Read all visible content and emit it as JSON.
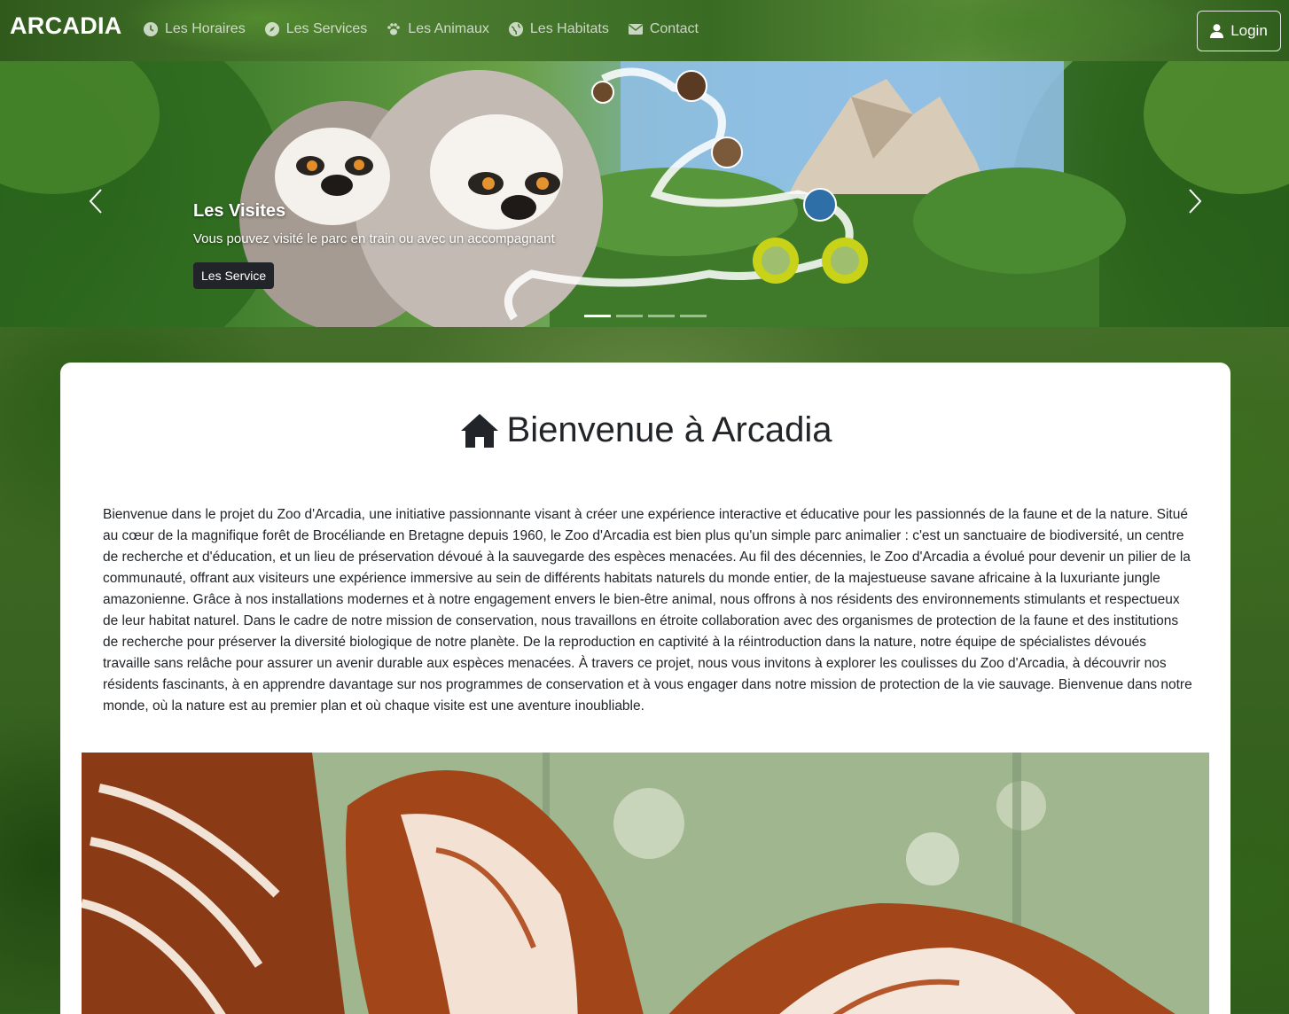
{
  "navbar": {
    "brand": "ARCADIA",
    "links": [
      {
        "label": "Les Horaires",
        "icon": "clock-icon"
      },
      {
        "label": "Les Services",
        "icon": "compass-icon"
      },
      {
        "label": "Les Animaux",
        "icon": "paw-icon"
      },
      {
        "label": "Les Habitats",
        "icon": "globe-icon"
      },
      {
        "label": "Contact",
        "icon": "envelope-icon"
      }
    ],
    "login_label": "Login"
  },
  "carousel": {
    "slide_title": "Les Visites",
    "slide_text": "Vous pouvez visité le parc en train ou avec un accompagnant",
    "slide_button": "Les Service",
    "indicator_count": 4,
    "active_indicator": 0
  },
  "main": {
    "title": "Bienvenue à Arcadia",
    "intro": "Bienvenue dans le projet du Zoo d'Arcadia, une initiative passionnante visant à créer une expérience interactive et éducative pour les passionnés de la faune et de la nature. Situé au cœur de la magnifique forêt de Brocéliande en Bretagne depuis 1960, le Zoo d'Arcadia est bien plus qu'un simple parc animalier : c'est un sanctuaire de biodiversité, un centre de recherche et d'éducation, et un lieu de préservation dévoué à la sauvegarde des espèces menacées. Au fil des décennies, le Zoo d'Arcadia a évolué pour devenir un pilier de la communauté, offrant aux visiteurs une expérience immersive au sein de différents habitats naturels du monde entier, de la majestueuse savane africaine à la luxuriante jungle amazonienne. Grâce à nos installations modernes et à notre engagement envers le bien-être animal, nous offrons à nos résidents des environnements stimulants et respectueux de leur habitat naturel. Dans le cadre de notre mission de conservation, nous travaillons en étroite collaboration avec des organismes de protection de la faune et des institutions de recherche pour préserver la diversité biologique de notre planète. De la reproduction en captivité à la réintroduction dans la nature, notre équipe de spécialistes dévoués travaille sans relâche pour assurer un avenir durable aux espèces menacées. À travers ce projet, nous vous invitons à explorer les coulisses du Zoo d'Arcadia, à découvrir nos résidents fascinants, à en apprendre davantage sur nos programmes de conservation et à vous engager dans notre mission de protection de la vie sauvage. Bienvenue dans notre monde, où la nature est au premier plan et où chaque visite est une aventure inoubliable."
  }
}
